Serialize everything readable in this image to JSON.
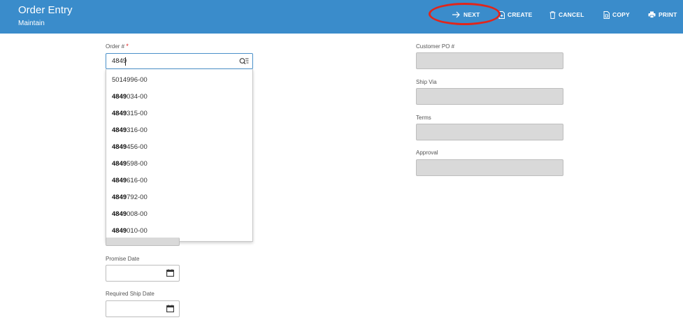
{
  "header": {
    "title": "Order Entry",
    "subtitle": "Maintain",
    "accent": "#3a8ccb"
  },
  "toolbar": {
    "next": "NEXT",
    "create": "CREATE",
    "cancel": "CANCEL",
    "copy": "COPY",
    "print": "PRINT"
  },
  "left": {
    "order_label": "Order #",
    "required_mark": "*",
    "order_value": "4849",
    "suggestions": [
      {
        "bold": "",
        "rest": "5014996-00"
      },
      {
        "bold": "4849",
        "rest": "034-00"
      },
      {
        "bold": "4849",
        "rest": "315-00"
      },
      {
        "bold": "4849",
        "rest": "316-00"
      },
      {
        "bold": "4849",
        "rest": "456-00"
      },
      {
        "bold": "4849",
        "rest": "598-00"
      },
      {
        "bold": "4849",
        "rest": "616-00"
      },
      {
        "bold": "4849",
        "rest": "792-00"
      },
      {
        "bold": "4849",
        "rest": "008-00"
      },
      {
        "bold": "4849",
        "rest": "010-00"
      }
    ],
    "promise_date_label": "Promise Date",
    "required_ship_date_label": "Required Ship Date"
  },
  "right": {
    "customer_po_label": "Customer PO #",
    "ship_via_label": "Ship Via",
    "terms_label": "Terms",
    "approval_label": "Approval"
  }
}
